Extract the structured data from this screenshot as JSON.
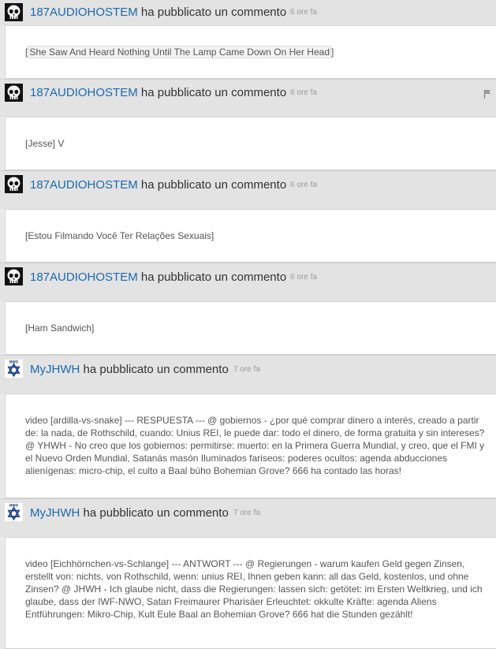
{
  "action_text": "ha pubblicato un commento",
  "comments": [
    {
      "user": "187AUDIOHOSTEM",
      "time": "6 ore fa",
      "avatar": "skull-avatar",
      "body_open": "[",
      "body_title": "She Saw And Heard Nothing Until The Lamp Came Down On Her Head",
      "body_close": "]"
    },
    {
      "user": "187AUDIOHOSTEM",
      "time": "6 ore fa",
      "avatar": "skull-avatar",
      "flag_icon": "flag-icon",
      "body": "[Jesse] V"
    },
    {
      "user": "187AUDIOHOSTEM",
      "time": "6 ore fa",
      "avatar": "skull-avatar",
      "body": "[Estou Filmando Você Ter Relações Sexuais]"
    },
    {
      "user": "187AUDIOHOSTEM",
      "time": "6 ore fa",
      "avatar": "skull-avatar",
      "body": "[Ham Sandwich]"
    },
    {
      "user": "MyJHWH",
      "time": "7 ore fa",
      "avatar": "star-of-david-avatar",
      "avatar_text": "NWO",
      "body": "video [ardilla-vs-snake] --- RESPUESTA --- @ gobiernos - ¿por qué comprar dinero a interés, creado a partir de: la nada, de Rothschild, cuando: Unius REI, le puede dar: todo el dinero, de forma gratuita y sin intereses? @ YHWH - No creo que los gobiernos: permitirse: muerto: en la Primera Guerra Mundial, y creo, que el FMI y el Nuevo Orden Mundial, Satanás masón Iluminados fariseos: poderes ocultos: agenda abducciones alienígenas: micro-chip, el culto a Baal búho Bohemian Grove? 666 ha contado las horas!"
    },
    {
      "user": "MyJHWH",
      "time": "7 ore fa",
      "avatar": "star-of-david-avatar",
      "avatar_text": "NWO",
      "body": "video [Eichhörnchen-vs-Schlange] --- ANTWORT --- @ Regierungen - warum kaufen Geld gegen Zinsen, erstellt von: nichts, von Rothschild, wenn: unius REI, Ihnen geben kann: all das Geld, kostenlos, und ohne Zinsen? @ JHWH - Ich glaube nicht, dass die Regierungen: lassen sich: getötet: im Ersten Weltkrieg, und ich glaube, dass der IWF-NWO, Satan Freimaurer Pharisäer Erleuchtet: okkulte Kräfte: agenda Aliens Entführungen: Mikro-Chip, Kult Eule Baal an Bohemian Grove? 666 hat die Stunden gezählt!"
    }
  ]
}
